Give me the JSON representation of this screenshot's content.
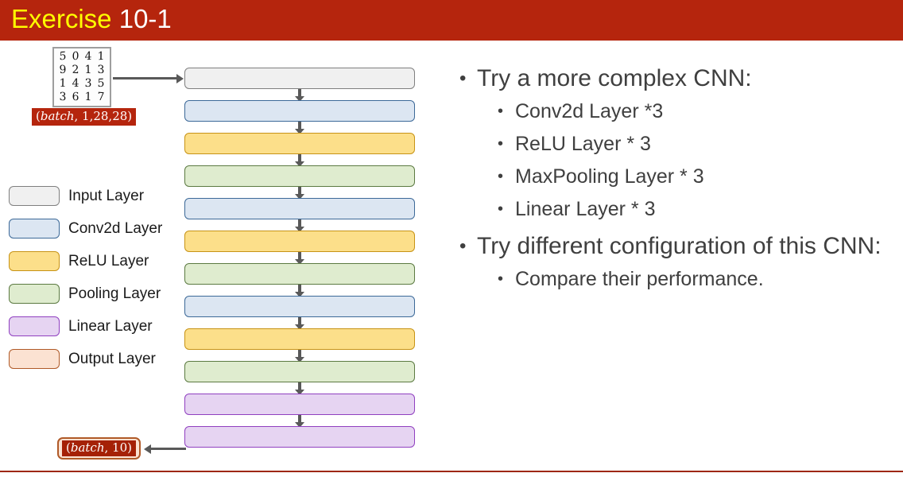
{
  "slide": {
    "title_highlight": "Exercise",
    "title_rest": "10-1",
    "title_highlight_color": "#ffff00",
    "title_bar_color": "#b5250d",
    "footer_rule_color": "#9e2710"
  },
  "thumbnail": {
    "name": "mnist-sample-grid",
    "rows": [
      [
        "5",
        "0",
        "4",
        "1"
      ],
      [
        "9",
        "2",
        "1",
        "3"
      ],
      [
        "1",
        "4",
        "3",
        "5"
      ],
      [
        "3",
        "6",
        "1",
        "7"
      ]
    ]
  },
  "shapes": {
    "input_var": "batch",
    "input_dims": ", 1,28,28)",
    "input_open": "(",
    "input_full": "(batch, 1,28,28)",
    "output_var": "batch",
    "output_dims": ", 10)",
    "output_open": "(",
    "output_full": "(batch, 10)"
  },
  "legend": {
    "items": [
      {
        "label": "Input Layer",
        "fill": "#f0f0f0",
        "border": "#7f7f7f"
      },
      {
        "label": "Conv2d Layer",
        "fill": "#dce6f2",
        "border": "#3c6998"
      },
      {
        "label": "ReLU Layer",
        "fill": "#fcdf8a",
        "border": "#c79316"
      },
      {
        "label": "Pooling Layer",
        "fill": "#dfeccf",
        "border": "#5c7a42"
      },
      {
        "label": "Linear Layer",
        "fill": "#e6d4f2",
        "border": "#9040c0"
      },
      {
        "label": "Output Layer",
        "fill": "#fbe2d2",
        "border": "#b05a28"
      }
    ]
  },
  "diagram": {
    "layers": [
      {
        "type": "Input Layer",
        "fill": "#f0f0f0",
        "border": "#7f7f7f"
      },
      {
        "type": "Conv2d Layer",
        "fill": "#dce6f2",
        "border": "#3c6998"
      },
      {
        "type": "ReLU Layer",
        "fill": "#fcdf8a",
        "border": "#c79316"
      },
      {
        "type": "Pooling Layer",
        "fill": "#dfeccf",
        "border": "#5c7a42"
      },
      {
        "type": "Conv2d Layer",
        "fill": "#dce6f2",
        "border": "#3c6998"
      },
      {
        "type": "ReLU Layer",
        "fill": "#fcdf8a",
        "border": "#c79316"
      },
      {
        "type": "Pooling Layer",
        "fill": "#dfeccf",
        "border": "#5c7a42"
      },
      {
        "type": "Conv2d Layer",
        "fill": "#dce6f2",
        "border": "#3c6998"
      },
      {
        "type": "ReLU Layer",
        "fill": "#fcdf8a",
        "border": "#c79316"
      },
      {
        "type": "Pooling Layer",
        "fill": "#dfeccf",
        "border": "#5c7a42"
      },
      {
        "type": "Linear Layer",
        "fill": "#e6d4f2",
        "border": "#9040c0"
      },
      {
        "type": "Linear Layer",
        "fill": "#e6d4f2",
        "border": "#9040c0"
      }
    ]
  },
  "body": {
    "groups": [
      {
        "heading": "Try a more complex CNN:",
        "items": [
          "Conv2d Layer *3",
          "ReLU Layer * 3",
          "MaxPooling Layer * 3",
          "Linear Layer * 3"
        ]
      },
      {
        "heading": "Try different configuration of this CNN:",
        "items": [
          "Compare their performance."
        ]
      }
    ],
    "bullet_glyph": "•",
    "text_color": "#3f3f3f"
  }
}
